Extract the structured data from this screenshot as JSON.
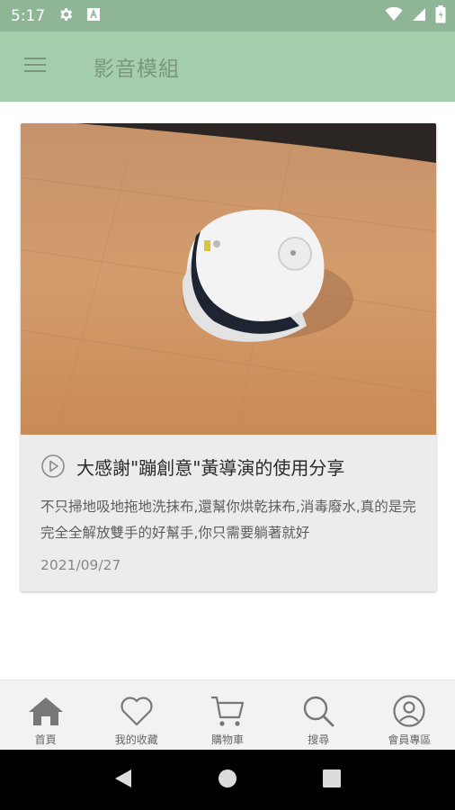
{
  "status_bar": {
    "time": "5:17"
  },
  "app_bar": {
    "title": "影音模組"
  },
  "video": {
    "title": "大感謝\"蹦創意\"黃導演的使用分享",
    "description": "不只掃地吸地拖地洗抹布,還幫你烘乾抹布,消毒廢水,真的是完完全全解放雙手的好幫手,你只需要躺著就好",
    "date": "2021/09/27"
  },
  "tabs": [
    {
      "label": "首頁",
      "icon": "home-icon"
    },
    {
      "label": "我的收藏",
      "icon": "heart-icon"
    },
    {
      "label": "購物車",
      "icon": "cart-icon"
    },
    {
      "label": "搜尋",
      "icon": "search-icon"
    },
    {
      "label": "會員專區",
      "icon": "account-icon"
    }
  ],
  "colors": {
    "status_bar": "#8fb597",
    "app_bar": "#a4ceab",
    "title_text": "#7a9580"
  }
}
